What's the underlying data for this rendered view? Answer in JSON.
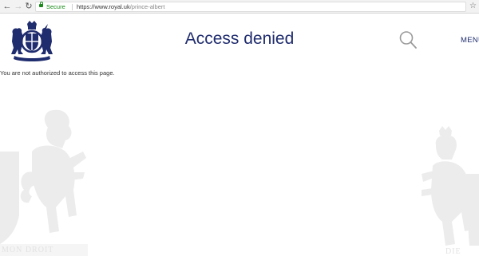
{
  "browser": {
    "secure_label": "Secure",
    "url_host": "https://www.royal.uk",
    "url_path": "/prince-albert"
  },
  "header": {
    "title": "Access denied",
    "menu_label": "MENU"
  },
  "main": {
    "message": "You are not authorized to access this page."
  },
  "watermark": {
    "left_motto": "MON DROIT",
    "right_motto": "DIE"
  },
  "colors": {
    "brand_blue": "#1f2c6e",
    "secure_green": "#1a8a1a"
  }
}
